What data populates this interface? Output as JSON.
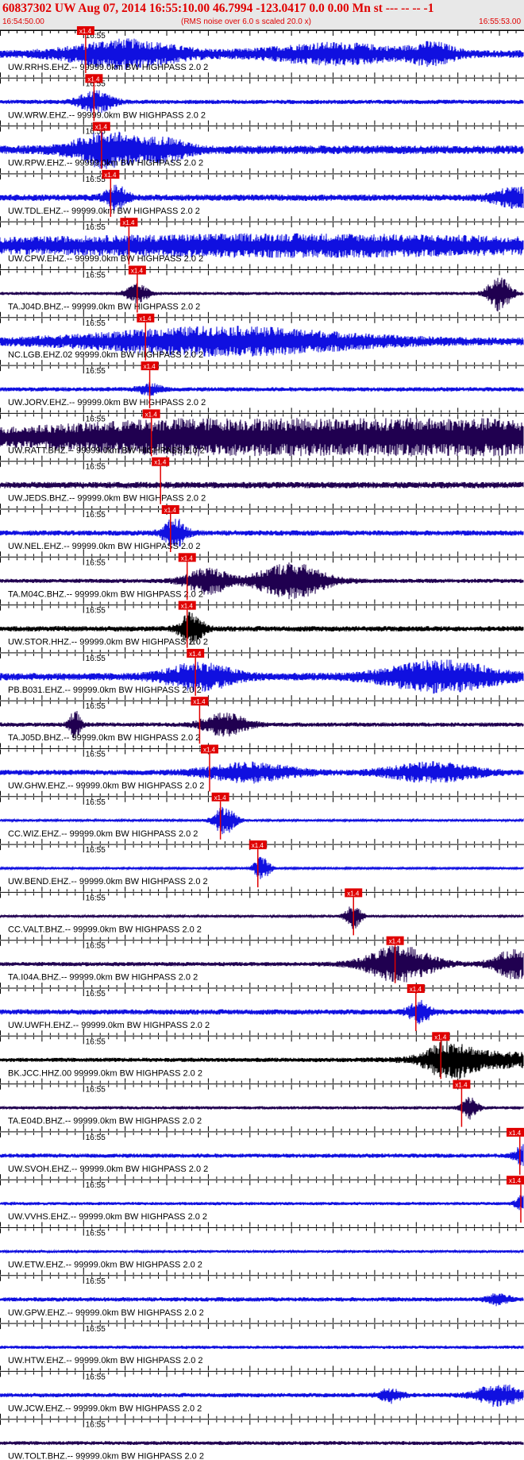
{
  "header": {
    "title": "60837302 UW Aug 07, 2014 16:55:10.00   46.7994 -123.0417  0.0 0.00 Mn st --- -- --   -1",
    "start_time": "16:54:50.00",
    "noise_note": "(RMS noise over 6.0 s scaled 20.0 x)",
    "end_time": "16:55:53.00"
  },
  "colors": {
    "header_bg": "#e8e8e8",
    "header_text": "#e00000",
    "trace_blue": "#1010e0",
    "trace_dark": "#200050",
    "trace_black": "#000000",
    "pick": "#e00000"
  },
  "chart_data": {
    "type": "seismogram",
    "x_unit": "seconds after 16:54:50.00",
    "xlim": [
      0,
      63
    ],
    "minute_tick_label": "16:55",
    "minute_tick_at": 10,
    "pick_label": "x1.4",
    "traces": [
      {
        "label": "UW.RRHS.EHZ.-- 99999.0km BW  HIGHPASS  2.0  2",
        "color": "blue",
        "pick": 10.3,
        "bursts": [
          [
            15,
            5,
            0.7
          ],
          [
            40,
            6,
            0.5
          ],
          [
            52,
            2,
            0.5
          ]
        ],
        "noise": 0.35
      },
      {
        "label": "UW.WRW.EHZ.-- 99999.0km BW  HIGHPASS  2.0  2",
        "color": "blue",
        "pick": 11.3,
        "bursts": [
          [
            11.5,
            1.5,
            0.6
          ]
        ],
        "noise": 0.2
      },
      {
        "label": "UW.RPW.EHZ.-- 99999.0km BW  HIGHPASS  2.0  2",
        "color": "blue",
        "pick": 12.2,
        "bursts": [
          [
            13,
            3,
            0.9
          ],
          [
            20,
            2,
            0.5
          ]
        ],
        "noise": 0.4
      },
      {
        "label": "UW.TDL.EHZ.-- 99999.0km BW  HIGHPASS  2.0  2",
        "color": "blue",
        "pick": 13.3,
        "bursts": [
          [
            14,
            1,
            0.6
          ],
          [
            62,
            2,
            0.5
          ]
        ],
        "noise": 0.3
      },
      {
        "label": "UW.CPW.EHZ.-- 99999.0km BW  HIGHPASS  2.0  2",
        "color": "blue",
        "pick": 15.5,
        "bursts": [
          [
            35,
            25,
            0.35
          ]
        ],
        "noise": 0.6
      },
      {
        "label": "TA.J04D.BHZ.-- 99999.0km BW  HIGHPASS  2.0  2",
        "color": "dark",
        "pick": 16.5,
        "bursts": [
          [
            16.5,
            1,
            0.5
          ],
          [
            60,
            1,
            1.0
          ]
        ],
        "noise": 0.15
      },
      {
        "label": "NC.LGB.EHZ.02 99999.0km BW  HIGHPASS  2.0  2",
        "color": "blue",
        "pick": 17.5,
        "bursts": [
          [
            27,
            12,
            0.7
          ]
        ],
        "noise": 0.35
      },
      {
        "label": "UW.JORV.EHZ.-- 99999.0km BW  HIGHPASS  2.0  2",
        "color": "blue",
        "pick": 18,
        "bursts": [
          [
            18,
            1,
            0.3
          ]
        ],
        "noise": 0.2
      },
      {
        "label": "UW.RATT.BHZ.-- 99999.0km BW  HIGHPASS  2.0  2",
        "color": "dark",
        "pick": 18.2,
        "bursts": [
          [
            30,
            20,
            0.9
          ],
          [
            55,
            8,
            0.7
          ]
        ],
        "noise": 0.5
      },
      {
        "label": "UW.JEDS.BHZ.-- 99999.0km BW  HIGHPASS  2.0  2",
        "color": "dark",
        "pick": 19.3,
        "bursts": [],
        "noise": 0.3
      },
      {
        "label": "UW.NEL.EHZ.-- 99999.0km BW  HIGHPASS  2.0  2",
        "color": "blue",
        "pick": 20.5,
        "bursts": [
          [
            21,
            1,
            0.8
          ]
        ],
        "noise": 0.25
      },
      {
        "label": "TA.M04C.BHZ.-- 99999.0km BW  HIGHPASS  2.0  2",
        "color": "dark",
        "pick": 22.5,
        "bursts": [
          [
            25,
            2,
            0.7
          ],
          [
            35,
            3,
            1.0
          ]
        ],
        "noise": 0.2
      },
      {
        "label": "UW.STOR.HHZ.-- 99999.0km BW  HIGHPASS  2.0  2",
        "color": "black",
        "pick": 22.5,
        "bursts": [
          [
            23,
            1,
            0.9
          ]
        ],
        "noise": 0.25
      },
      {
        "label": "PB.B031.EHZ.-- 99999.0km BW  HIGHPASS  2.0  2",
        "color": "blue",
        "pick": 23.5,
        "bursts": [
          [
            24,
            3,
            0.7
          ],
          [
            53,
            5,
            0.8
          ]
        ],
        "noise": 0.35
      },
      {
        "label": "TA.J05D.BHZ.-- 99999.0km BW  HIGHPASS  2.0  2",
        "color": "dark",
        "pick": 24,
        "bursts": [
          [
            9,
            0.5,
            0.8
          ],
          [
            27,
            2,
            0.6
          ]
        ],
        "noise": 0.2
      },
      {
        "label": "UW.GHW.EHZ.-- 99999.0km BW  HIGHPASS  2.0  2",
        "color": "blue",
        "pick": 25.2,
        "bursts": [
          [
            30,
            4,
            0.5
          ],
          [
            52,
            4,
            0.5
          ]
        ],
        "noise": 0.25
      },
      {
        "label": "CC.WIZ.EHZ.-- 99999.0km BW  HIGHPASS  2.0  2",
        "color": "blue",
        "pick": 26.5,
        "bursts": [
          [
            27,
            1,
            0.8
          ]
        ],
        "noise": 0.1
      },
      {
        "label": "UW.BEND.EHZ.-- 99999.0km BW  HIGHPASS  2.0  2",
        "color": "blue",
        "pick": 31,
        "bursts": [
          [
            31.5,
            0.7,
            0.7
          ]
        ],
        "noise": 0.08
      },
      {
        "label": "CC.VALT.BHZ.-- 99999.0km BW  HIGHPASS  2.0  2",
        "color": "dark",
        "pick": 42.5,
        "bursts": [
          [
            42.5,
            0.7,
            0.7
          ]
        ],
        "noise": 0.1
      },
      {
        "label": "TA.I04A.BHZ.-- 99999.0km BW  HIGHPASS  2.0  2",
        "color": "dark",
        "pick": 47.5,
        "bursts": [
          [
            48,
            3,
            1.0
          ],
          [
            62,
            2,
            0.8
          ]
        ],
        "noise": 0.2
      },
      {
        "label": "UW.UWFH.EHZ.-- 99999.0km BW  HIGHPASS  2.0  2",
        "color": "blue",
        "pick": 50,
        "bursts": [
          [
            50.5,
            1,
            0.6
          ]
        ],
        "noise": 0.25
      },
      {
        "label": "BK.JCC.HHZ.00 99999.0km BW  HIGHPASS  2.0  2",
        "color": "black",
        "pick": 53,
        "bursts": [
          [
            54,
            2,
            0.9
          ],
          [
            60,
            6,
            0.4
          ]
        ],
        "noise": 0.2
      },
      {
        "label": "TA.E04D.BHZ.-- 99999.0km BW  HIGHPASS  2.0  2",
        "color": "dark",
        "pick": 55.5,
        "bursts": [
          [
            56.5,
            0.7,
            0.6
          ]
        ],
        "noise": 0.15
      },
      {
        "label": "UW.SVOH.EHZ.-- 99999.0km BW  HIGHPASS  2.0  2",
        "color": "blue",
        "pick": 62.5,
        "bursts": [
          [
            63,
            0.8,
            0.6
          ]
        ],
        "noise": 0.2
      },
      {
        "label": "UW.VVHS.EHZ.-- 99999.0km BW  HIGHPASS  2.0  2",
        "color": "blue",
        "pick": 63.5,
        "bursts": [
          [
            63,
            0.7,
            0.5
          ]
        ],
        "noise": 0.15
      },
      {
        "label": "UW.ETW.EHZ.-- 99999.0km BW  HIGHPASS  2.0  2",
        "color": "blue",
        "pick": null,
        "bursts": [],
        "noise": 0.12
      },
      {
        "label": "UW.GPW.EHZ.-- 99999.0km BW  HIGHPASS  2.0  2",
        "color": "blue",
        "pick": null,
        "bursts": [
          [
            60,
            1,
            0.3
          ]
        ],
        "noise": 0.2
      },
      {
        "label": "UW.HTW.EHZ.-- 99999.0km BW  HIGHPASS  2.0  2",
        "color": "blue",
        "pick": null,
        "bursts": [],
        "noise": 0.15
      },
      {
        "label": "UW.JCW.EHZ.-- 99999.0km BW  HIGHPASS  2.0  2",
        "color": "blue",
        "pick": null,
        "bursts": [
          [
            60,
            2,
            0.6
          ],
          [
            47,
            1,
            0.4
          ]
        ],
        "noise": 0.2
      },
      {
        "label": "UW.TOLT.BHZ.-- 99999.0km BW  HIGHPASS  2.0  2",
        "color": "dark",
        "pick": null,
        "bursts": [],
        "noise": 0.18
      }
    ]
  }
}
